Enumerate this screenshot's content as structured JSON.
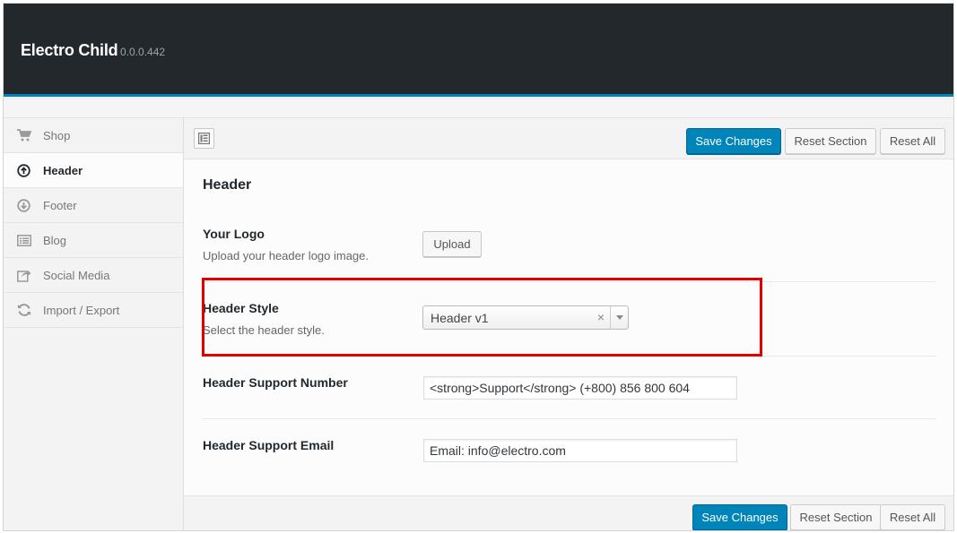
{
  "header": {
    "title": "Electro Child",
    "version": "0.0.0.442"
  },
  "sidebar": {
    "items": [
      {
        "label": "Shop",
        "icon": "cart-icon",
        "active": false
      },
      {
        "label": "Header",
        "icon": "arrow-up-circle-icon",
        "active": true
      },
      {
        "label": "Footer",
        "icon": "arrow-down-circle-icon",
        "active": false
      },
      {
        "label": "Blog",
        "icon": "list-icon",
        "active": false
      },
      {
        "label": "Social Media",
        "icon": "share-icon",
        "active": false
      },
      {
        "label": "Import / Export",
        "icon": "refresh-icon",
        "active": false
      }
    ]
  },
  "toolbar": {
    "save_label": "Save Changes",
    "reset_section_label": "Reset Section",
    "reset_all_label": "Reset All"
  },
  "section": {
    "title": "Header"
  },
  "fields": {
    "logo": {
      "label": "Your Logo",
      "desc": "Upload your header logo image.",
      "button_label": "Upload"
    },
    "style": {
      "label": "Header Style",
      "desc": "Select the header style.",
      "value": "Header v1",
      "clear": "×"
    },
    "support_number": {
      "label": "Header Support Number",
      "value": "<strong>Support</strong> (+800) 856 800 604"
    },
    "support_email": {
      "label": "Header Support Email",
      "value": "Email: info@electro.com"
    }
  },
  "colors": {
    "accent": "#0085ba",
    "header_bg": "#23282d",
    "highlight": "#e00000"
  }
}
